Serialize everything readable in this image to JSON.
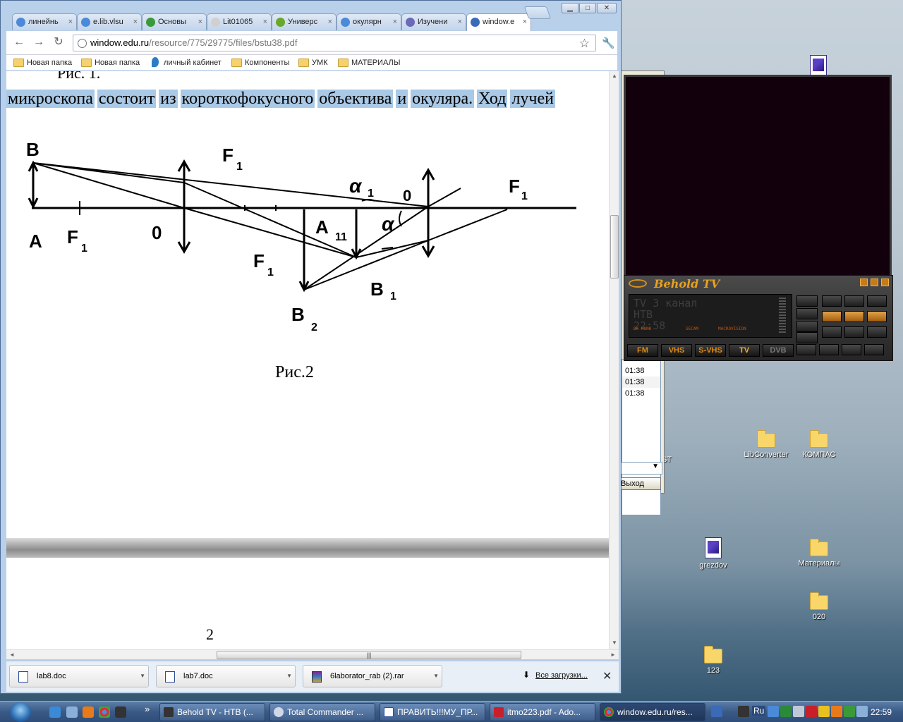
{
  "browser": {
    "tabs": [
      {
        "label": "линейнь",
        "color": "#4a8ad8"
      },
      {
        "label": "e.lib.vlsu",
        "color": "#4a8ad8"
      },
      {
        "label": "Основы",
        "color": "#3a9a3a"
      },
      {
        "label": "Lit01065",
        "color": "#d0d0d0"
      },
      {
        "label": "Универс",
        "color": "#6aa82a"
      },
      {
        "label": "окулярн",
        "color": "#4a8ad8"
      },
      {
        "label": "Изучени",
        "color": "#6a6ab8"
      },
      {
        "label": "window.e",
        "color": "#3a6ab8"
      }
    ],
    "tab_close": "×",
    "window_controls": {
      "minimize": "▁",
      "maximize": "□",
      "close": "✕"
    },
    "url_host": "window.edu.ru",
    "url_path": "/resource/775/29775/files/bstu38.pdf",
    "bookmarks": [
      "Новая папка",
      "Новая папка",
      "личный кабинет",
      "Компоненты",
      "УМК",
      "МАТЕРИАЛЫ"
    ]
  },
  "document": {
    "prev_caption": "Рис. 1.",
    "highlight_words": [
      "микроскопа",
      "состоит",
      "из",
      "короткофокусного",
      "объектива",
      "и",
      "окуляра.",
      "Ход",
      "лучей"
    ],
    "figure_caption": "Рис.2",
    "page_number": "2",
    "labels": {
      "B": "B",
      "A": "A",
      "F": "F",
      "one": "1",
      "O": "0",
      "A11": "A",
      "eleven": "11",
      "B1": "B",
      "B2": "B",
      "two": "2",
      "alpha": "α",
      "alpha1": "α"
    }
  },
  "downloads": {
    "items": [
      "lab8.doc",
      "lab7.doc",
      "6laborator_rab (2).rar"
    ],
    "all": "Все загрузки...",
    "close": "✕"
  },
  "commander": {
    "times": [
      "01:38",
      "01:38",
      "01:38"
    ],
    "exit": "Выход"
  },
  "behold": {
    "title": "Behold TV",
    "lcd_lines": [
      "TV 3 канал",
      "НТВ",
      "22:58"
    ],
    "lcd_small": [
      "DK MONO",
      "SECAM",
      "MACROVISION"
    ],
    "modes": [
      "FM",
      "VHS",
      "S-VHS",
      "TV",
      "DVB"
    ]
  },
  "desktop": {
    "icons": [
      "LibConverter",
      "КОМПАС",
      "grezdov",
      "Материалы",
      "020",
      "123"
    ],
    "partial_label": "ST"
  },
  "taskbar": {
    "tasks": [
      "Behold TV - НТВ (...",
      "Total Commander ...",
      "ПРАВИТЬ!!!МУ_ПР...",
      "itmo223.pdf - Ado...",
      "window.edu.ru/res..."
    ],
    "lang": "Ru",
    "clock": "22:59",
    "more": "»"
  }
}
